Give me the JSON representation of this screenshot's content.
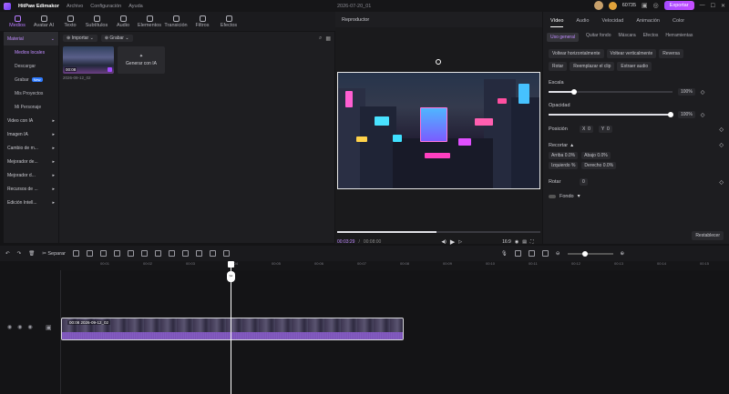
{
  "titlebar": {
    "app": "HitPaw Edimakor",
    "menus": [
      "Archivo",
      "Configuración",
      "Ayuda"
    ],
    "project": "2026-07-20_01",
    "coins": "60735",
    "export": "Exportar"
  },
  "toolbar": {
    "tabs": [
      "Medios",
      "Avatar AI",
      "Texto",
      "Subtítulos",
      "Audio",
      "Elementos",
      "Transición",
      "Filtros",
      "Efectos"
    ]
  },
  "leftnav": {
    "material": "Material",
    "local": "Medios locales",
    "download": "Descargar",
    "record": "Grabar",
    "record_badge": "New",
    "projects": "Mis Proyectos",
    "personal": "Mi Personaje",
    "groups": [
      "Video con IA",
      "Imagen IA",
      "Cambio de m...",
      "Mejorador de...",
      "Mejorador d...",
      "Recursos de ...",
      "Edición Intell..."
    ]
  },
  "media": {
    "import": "Importar",
    "record": "Grabar",
    "clip_time": "00:08",
    "clip_name": "2026-09-12_02",
    "generate": "Generar con IA"
  },
  "player": {
    "title": "Reproductor",
    "current": "00:03:29",
    "total": "00:08:00",
    "ratio": "16:9"
  },
  "props": {
    "tabs": [
      "Vídeo",
      "Audio",
      "Velocidad",
      "Animación",
      "Color"
    ],
    "subtabs": [
      "Uso general",
      "Quitar fondo",
      "Máscara",
      "Efectos",
      "Herramientas"
    ],
    "btn_flip_h": "Voltear horizontalmente",
    "btn_flip_v": "Voltear verticalmente",
    "btn_reverse": "Reversa",
    "btn_rotate": "Rotar",
    "btn_replace": "Reemplazar el clip",
    "btn_extract": "Extraer audio",
    "scale_label": "Escala",
    "scale_value": "100%",
    "opacity_label": "Opacidad",
    "opacity_value": "100%",
    "position_label": "Posición",
    "pos_x_label": "X",
    "pos_x": "0",
    "pos_y_label": "Y",
    "pos_y": "0",
    "crop_label": "Recortar",
    "crop_top_label": "Arriba",
    "crop_top": "0.0%",
    "crop_bottom_label": "Abajo",
    "crop_bottom": "0.0%",
    "crop_left_label": "Izquierdo",
    "crop_left": "%",
    "crop_right_label": "Derecho",
    "crop_right": "0.0%",
    "rotate_label": "Rotar",
    "rotate_value": "0",
    "bg_label": "Fondo",
    "reset": "Restablecer"
  },
  "timeline": {
    "split": "Separar",
    "ticks": [
      "00:01",
      "00:02",
      "00:03",
      "00:04",
      "00:05",
      "00:06",
      "00:07",
      "00:08",
      "00:09",
      "00:10",
      "00:11",
      "00:12",
      "00:13",
      "00:14",
      "00:15"
    ],
    "clip_time": "00:08",
    "clip_name": "2026-09-12_02"
  }
}
